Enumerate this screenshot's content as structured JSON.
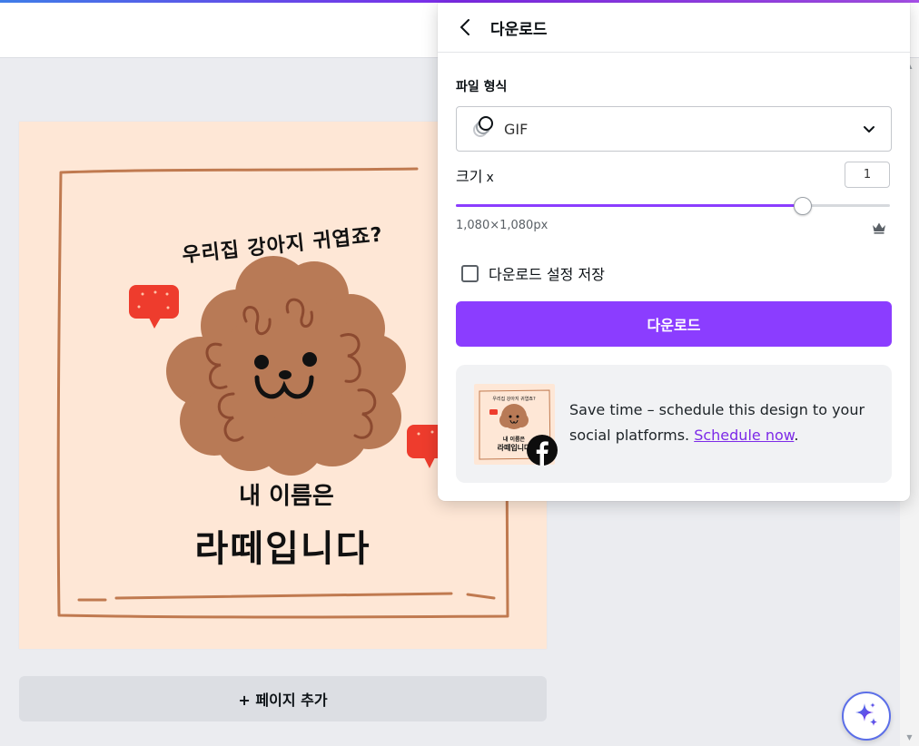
{
  "panel": {
    "title": "다운로드",
    "file_type_label": "파일 형식",
    "file_type_value": "GIF",
    "size_label": "크기",
    "size_multiplier_symbol": "x",
    "size_value": "1",
    "size_slider_fraction": 0.8,
    "dimensions_text": "1,080×1,080px",
    "save_settings_label": "다운로드 설정 저장",
    "save_settings_checked": false,
    "download_button_label": "다운로드",
    "promo": {
      "text": "Save time – schedule this design to your social platforms. ",
      "link_text": "Schedule now",
      "suffix": "."
    }
  },
  "design": {
    "headline": "우리집 강아지 귀엽죠?",
    "line1": "내 이름은",
    "line2": "라떼입니다",
    "thumbnail": {
      "headline": "우리집 강아지 귀엽죠?",
      "line1": "내 이름은",
      "line2": "라떼입니다"
    }
  },
  "add_page_label": "+ 페이지 추가",
  "colors": {
    "accent": "#8b3dff",
    "canvas_bg": "#fee7d6",
    "dog": "#b87a56",
    "frame": "#c07a50",
    "bubble": "#ee3c2d"
  }
}
